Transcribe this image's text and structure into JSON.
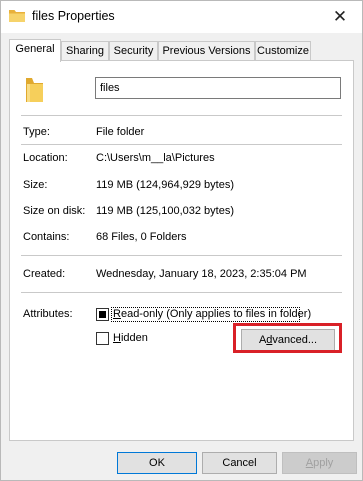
{
  "window": {
    "title": "files Properties",
    "close_glyph": "✕",
    "icon": "folder-icon"
  },
  "tabs": [
    {
      "label": "General",
      "active": true
    },
    {
      "label": "Sharing",
      "active": false
    },
    {
      "label": "Security",
      "active": false
    },
    {
      "label": "Previous Versions",
      "active": false
    },
    {
      "label": "Customize",
      "active": false
    }
  ],
  "general": {
    "name": "files",
    "type_label": "Type:",
    "type_value": "File folder",
    "location_label": "Location:",
    "location_value": "C:\\Users\\m__la\\Pictures",
    "size_label": "Size:",
    "size_value": "119 MB (124,964,929 bytes)",
    "size_on_disk_label": "Size on disk:",
    "size_on_disk_value": "119 MB (125,100,032 bytes)",
    "contains_label": "Contains:",
    "contains_value": "68 Files, 0 Folders",
    "created_label": "Created:",
    "created_value": "Wednesday, January 18, 2023, 2:35:04 PM",
    "attributes_label": "Attributes:",
    "readonly_label_u": "R",
    "readonly_label_rest": "ead-only (Only applies to files in folder)",
    "readonly_state": "indeterminate",
    "hidden_label_u": "H",
    "hidden_label_rest": "idden",
    "hidden_checked": false,
    "advanced_label_pre": "A",
    "advanced_label_u": "d",
    "advanced_label_rest": "vanced..."
  },
  "footer": {
    "ok_label": "OK",
    "cancel_label": "Cancel",
    "apply_label_u": "A",
    "apply_label_rest": "pply",
    "apply_enabled": false
  },
  "colors": {
    "highlight": "#d92027",
    "folder": "#f3c24f",
    "default_button_border": "#0078d7"
  }
}
